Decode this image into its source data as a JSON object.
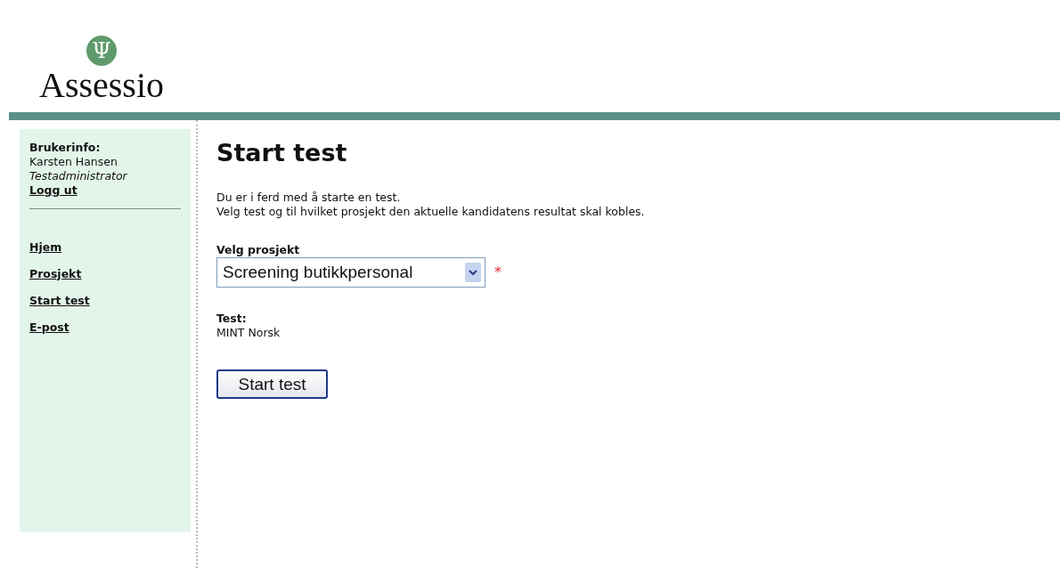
{
  "logo": {
    "name": "Assessio",
    "symbol": "Ψ"
  },
  "sidebar": {
    "user_heading": "Brukerinfo:",
    "user_name": "Karsten Hansen",
    "user_role": "Testadministrator",
    "logout": "Logg ut",
    "nav": [
      {
        "label": "Hjem"
      },
      {
        "label": "Prosjekt"
      },
      {
        "label": "Start test"
      },
      {
        "label": "E-post"
      }
    ]
  },
  "main": {
    "title": "Start test",
    "intro": [
      "Du er i ferd med å starte en test.",
      "Velg test og til hvilket prosjekt den aktuelle kandidatens resultat skal kobles."
    ],
    "project_label": "Velg prosjekt",
    "project_value": "Screening butikkpersonal",
    "required_mark": "*",
    "test_label": "Test:",
    "test_value": "MINT Norsk",
    "start_button": "Start test"
  }
}
